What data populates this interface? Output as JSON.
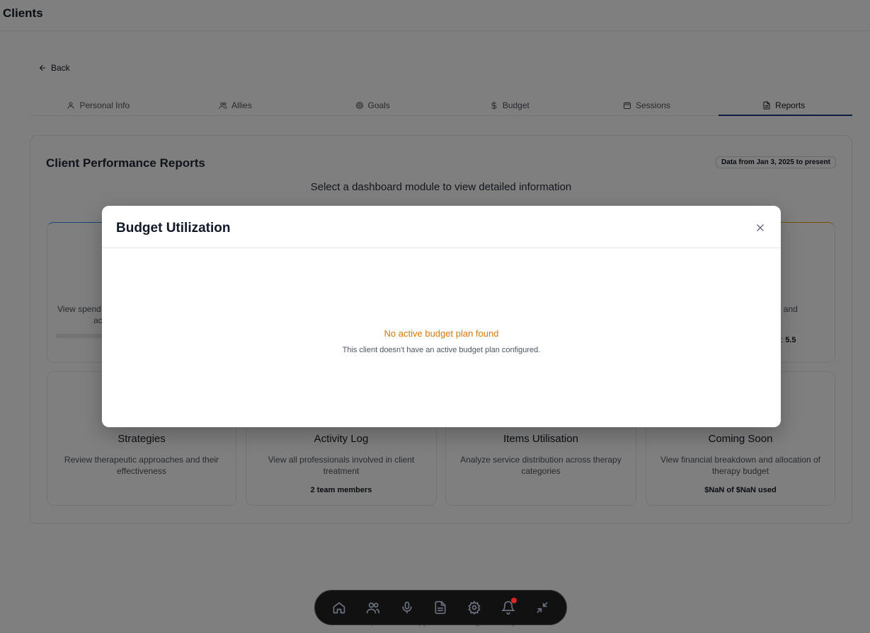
{
  "header": {
    "title": "Clients"
  },
  "back": {
    "label": "Back"
  },
  "tabs": [
    {
      "label": "Personal Info",
      "icon": "user-icon"
    },
    {
      "label": "Allies",
      "icon": "users-icon"
    },
    {
      "label": "Goals",
      "icon": "target-icon"
    },
    {
      "label": "Budget",
      "icon": "dollar-icon"
    },
    {
      "label": "Sessions",
      "icon": "calendar-icon"
    },
    {
      "label": "Reports",
      "icon": "file-icon",
      "active": true
    }
  ],
  "report": {
    "title": "Client Performance Reports",
    "date_badge": "Data from Jan 3, 2025 to present",
    "subtitle": "Select a dashboard module to view detailed information"
  },
  "top_cards": {
    "left": {
      "desc_line1": "View spend",
      "desc_line2": "ac"
    },
    "right": {
      "desc": "y, and",
      "meta_label": "d:",
      "meta_value": "5.5"
    }
  },
  "cards": [
    {
      "title": "Strategies",
      "desc": "Review therapeutic approaches and their effectiveness",
      "meta": ""
    },
    {
      "title": "Activity Log",
      "desc": "View all professionals involved in client treatment",
      "meta": "2 team members"
    },
    {
      "title": "Items Utilisation",
      "desc": "Analyze service distribution across therapy categories",
      "meta": ""
    },
    {
      "title": "Coming Soon",
      "desc": "View financial breakdown and allocation of therapy budget",
      "meta": "$NaN of $NaN used"
    }
  ],
  "modal": {
    "title": "Budget Utilization",
    "empty_title": "No active budget plan found",
    "empty_desc": "This client doesn't have an active budget plan configured."
  },
  "footer": {
    "text": "© 2025 Speech Therapy Client Management System"
  },
  "dock": [
    {
      "icon": "home-icon"
    },
    {
      "icon": "users-icon"
    },
    {
      "icon": "microphone-icon"
    },
    {
      "icon": "document-icon"
    },
    {
      "icon": "gear-icon"
    },
    {
      "icon": "bell-icon",
      "has_notification": true
    },
    {
      "icon": "minimize-icon"
    }
  ],
  "colors": {
    "overlay": "rgba(0,0,0,0.5)",
    "warning": "#d97706",
    "active_tab": "#1e3a8a",
    "notification": "#dc2626"
  }
}
